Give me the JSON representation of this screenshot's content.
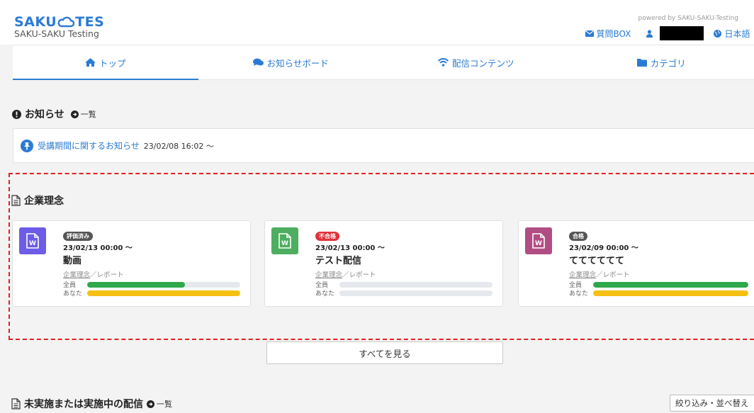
{
  "header": {
    "logo_main_left": "SAKU",
    "logo_main_right": "TES",
    "logo_sub": "SAKU-SAKU Testing",
    "powered": "powered by SAKU-SAKU-Testing",
    "question_box": "質問BOX",
    "language": "日本語"
  },
  "tabs": [
    {
      "label": "トップ",
      "icon": "home-icon"
    },
    {
      "label": "お知らせボード",
      "icon": "comments-icon"
    },
    {
      "label": "配信コンテンツ",
      "icon": "wifi-icon"
    },
    {
      "label": "カテゴリ",
      "icon": "folder-icon"
    }
  ],
  "notices": {
    "title": "お知らせ",
    "list_link": "一覧",
    "items": [
      {
        "text": "受講期間に関するお知らせ",
        "date": "23/02/08 16:02 ～"
      }
    ]
  },
  "philosophy": {
    "title": "企業理念",
    "cards": [
      {
        "badge": "評価済み",
        "badge_color": "#555555",
        "icon_color": "#6c5ce7",
        "date": "23/02/13 00:00 ～",
        "title": "動画",
        "category": "企業理念",
        "type": "／レポート",
        "all_label": "全員",
        "you_label": "あなた",
        "all_progress": 0.64,
        "you_progress": 1.0
      },
      {
        "badge": "不合格",
        "badge_color": "#e0323b",
        "icon_color": "#4cae5e",
        "date": "23/02/13 00:00 ～",
        "title": "テスト配信",
        "category": "企業理念",
        "type": "／レポート",
        "all_label": "全員",
        "you_label": "あなた",
        "all_progress": 0,
        "you_progress": 0
      },
      {
        "badge": "合格",
        "badge_color": "#555555",
        "icon_color": "#b04e84",
        "date": "23/02/09 00:00 ～",
        "title": "てててててて",
        "category": "企業理念",
        "type": "／レポート",
        "all_label": "全員",
        "you_label": "あなた",
        "all_progress": 1.0,
        "you_progress": 1.0
      }
    ],
    "see_all": "すべてを見る"
  },
  "pending": {
    "title": "未実施または実施中の配信",
    "list_link": "一覧",
    "filter_button": "絞り込み・並べ替え"
  },
  "colors": {
    "accent": "#2b7bd3",
    "bar_all": "#2ea84a",
    "bar_you": "#f6c012",
    "dash": "#e32020"
  }
}
